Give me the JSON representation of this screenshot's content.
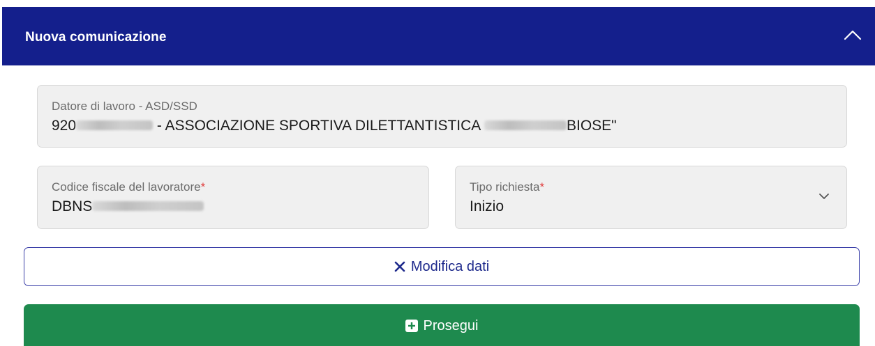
{
  "header": {
    "title": "Nuova comunicazione",
    "collapse_icon": "chevron-up-icon"
  },
  "form": {
    "datore": {
      "label": "Datore di lavoro - ASD/SSD",
      "value_prefix": "920",
      "value_middle": " - ASSOCIAZIONE SPORTIVA DILETTANTISTICA ",
      "value_suffix": "BIOSE\""
    },
    "codice_fiscale": {
      "label": "Codice fiscale del lavoratore",
      "required_mark": "*",
      "value_prefix": "DBNS"
    },
    "tipo_richiesta": {
      "label": "Tipo richiesta",
      "required_mark": "*",
      "value": "Inizio",
      "icon": "chevron-down-icon"
    }
  },
  "buttons": {
    "modifica_label": "Modifica dati",
    "modifica_icon": "close-icon",
    "prosegui_label": "Prosegui",
    "prosegui_icon": "plus-square-icon"
  },
  "colors": {
    "header_bg": "#141f8c",
    "primary_text": "#1e2a8c",
    "success": "#1e8a4e",
    "required": "#e03b3b",
    "field_bg": "#f0f0f0"
  }
}
